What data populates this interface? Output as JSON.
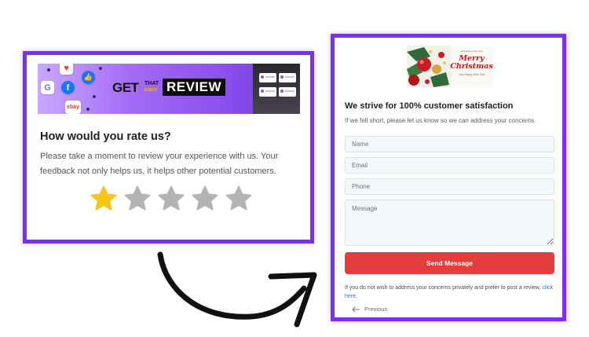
{
  "rating_card": {
    "banner": {
      "logo_get": "GET",
      "logo_that": "THAT",
      "logo_every": "EVERY",
      "logo_review": "REVIEW",
      "platform_icons": [
        "red-heart-icon",
        "google-icon",
        "facebook-icon",
        "thumbs-up-icon",
        "ebay-icon"
      ],
      "ebay_label": "ebay",
      "google_label": "G",
      "facebook_label": "f"
    },
    "title": "How would you rate us?",
    "description": "Please take a moment to review your experience with us. Your feedback not only helps us, it helps other potential customers.",
    "rating": {
      "value": 1,
      "max": 5
    },
    "colors": {
      "star_filled": "#f5c518",
      "star_empty": "#b3b3b3",
      "frame": "#7b2ff2"
    }
  },
  "feedback_form": {
    "banner": {
      "merry": "Merry",
      "christmas": "Christmas",
      "tagline": "And Happy New Year"
    },
    "title": "We strive for 100% customer satisfaction",
    "subtitle": "If we fell short, please let us know so we can address your concerns.",
    "fields": {
      "name_placeholder": "Name",
      "email_placeholder": "Email",
      "phone_placeholder": "Phone",
      "message_placeholder": "Message"
    },
    "send_label": "Send Message",
    "footnote_text": "If you do not wish to address your concerns privately and prefer to post a review,",
    "footnote_link": "click here",
    "footnote_end": ".",
    "previous_label": "Previous",
    "colors": {
      "send_button": "#e53d3e",
      "link": "#2f6fe0",
      "frame": "#7b2ff2"
    }
  },
  "connector": {
    "icon": "curved-arrow-icon"
  }
}
